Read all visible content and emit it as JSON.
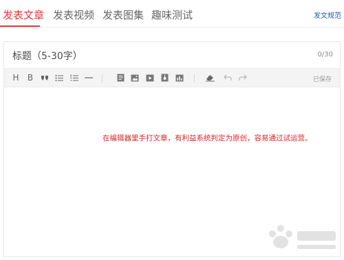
{
  "tabs": [
    {
      "label": "发表文章",
      "active": true
    },
    {
      "label": "发表视频",
      "active": false
    },
    {
      "label": "发表图集",
      "active": false
    },
    {
      "label": "趣味测试",
      "active": false
    }
  ],
  "header": {
    "spec_link": "发文规范"
  },
  "editor": {
    "title_placeholder": "标题（5-30字）",
    "title_count": "0/30",
    "toolbar": {
      "heading_label": "H",
      "bold_label": "B",
      "saved_label": "已保存",
      "icons": [
        "heading-icon",
        "bold-icon",
        "quote-icon",
        "bullet-list-icon",
        "numbered-list-icon",
        "horizontal-rule-icon",
        "document-icon",
        "image-icon",
        "video-icon",
        "audio-icon",
        "chart-icon",
        "eraser-icon",
        "undo-icon",
        "redo-icon"
      ]
    },
    "note": "在编辑器里手打文章，有利益系统判定为原创，容易通过试运营。"
  },
  "colors": {
    "accent": "#e03a3a",
    "link": "#1f5ea8",
    "note": "#d22a2a",
    "toolbar_bg": "#f4f4f4"
  }
}
